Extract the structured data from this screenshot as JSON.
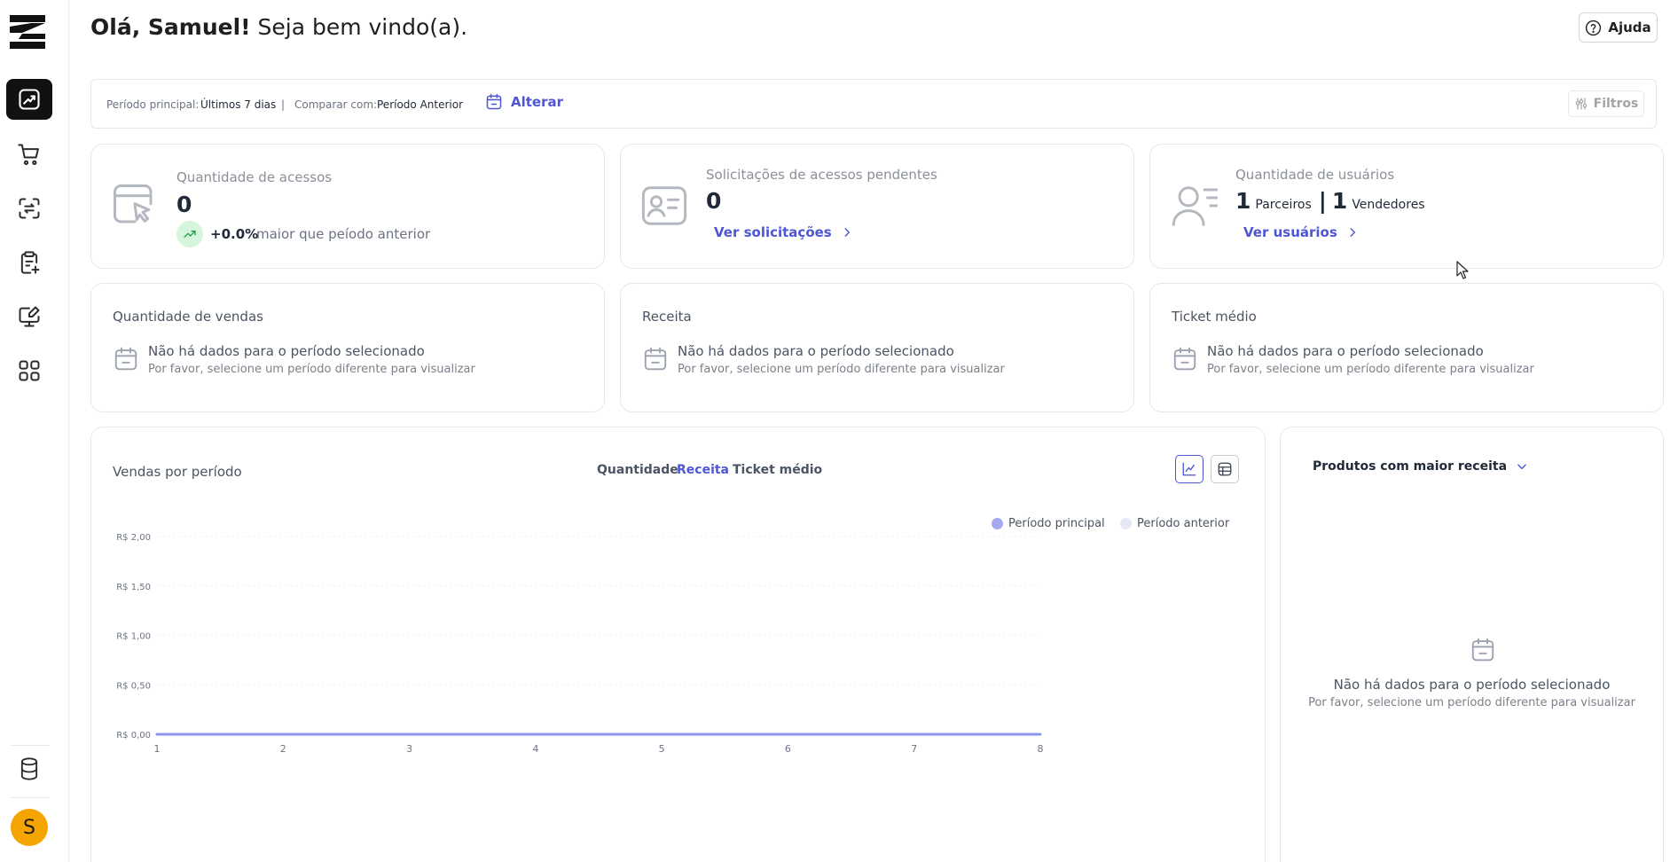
{
  "header": {
    "greeting_bold": "Olá, Samuel!",
    "greeting_rest": "Seja bem vindo(a).",
    "help_label": "Ajuda"
  },
  "period": {
    "main_label": "Período principal:",
    "main_value": "Últimos 7 dias",
    "separator": "|",
    "compare_label": "Comparar com:",
    "compare_value": "Período Anterior",
    "change_label": "Alterar",
    "filters_label": "Filtros"
  },
  "stats": {
    "accesses": {
      "title": "Quantidade de acessos",
      "value": "0",
      "trend": "+0.0%",
      "trend_text": "maior que peíodo anterior"
    },
    "pending": {
      "title": "Solicitações de acessos pendentes",
      "value": "0",
      "link": "Ver solicitações"
    },
    "users": {
      "title": "Quantidade de usuários",
      "partners_count": "1",
      "partners_label": "Parceiros",
      "sellers_count": "1",
      "sellers_label": "Vendedores",
      "link": "Ver usuários"
    }
  },
  "sales_cards": [
    {
      "title": "Quantidade de vendas",
      "empty_main": "Não há dados para o período selecionado",
      "empty_sub": "Por favor, selecione um período diferente para visualizar"
    },
    {
      "title": "Receita",
      "empty_main": "Não há dados para o período selecionado",
      "empty_sub": "Por favor, selecione um período diferente para visualizar"
    },
    {
      "title": "Ticket médio",
      "empty_main": "Não há dados para o período selecionado",
      "empty_sub": "Por favor, selecione um período diferente para visualizar"
    }
  ],
  "chart_panel": {
    "title": "Vendas por período",
    "tabs": [
      "Quantidade",
      "Receita",
      "Ticket médio"
    ],
    "active_tab": "Receita",
    "legend": [
      {
        "name": "Período principal",
        "color": "#a5a9f0"
      },
      {
        "name": "Período anterior",
        "color": "#e7e8f6"
      }
    ]
  },
  "chart_data": {
    "type": "line",
    "title": "Vendas por período",
    "x": [
      1,
      2,
      3,
      4,
      5,
      6,
      7,
      8
    ],
    "xlim": [
      1,
      8
    ],
    "ylim": [
      0,
      2
    ],
    "yticks": [
      0,
      0.5,
      1,
      1.5,
      2
    ],
    "ytick_labels": [
      "R$ 0,00",
      "R$ 0,50",
      "R$ 1,00",
      "R$ 1,50",
      "R$ 2,00"
    ],
    "series": [
      {
        "name": "Período principal",
        "values": [
          0,
          0,
          0,
          0,
          0,
          0,
          0,
          0
        ],
        "color": "#8f94ee"
      }
    ],
    "grid": true,
    "legend_position": "top-right"
  },
  "top_products": {
    "title": "Produtos com maior receita",
    "empty_main": "Não há dados para o período selecionado",
    "empty_sub": "Por favor, selecione um período diferente para visualizar"
  },
  "user": {
    "avatar_initial": "S"
  },
  "colors": {
    "accent": "#4f56d6",
    "avatar": "#f5a400",
    "sidebar_active": "#111111"
  }
}
